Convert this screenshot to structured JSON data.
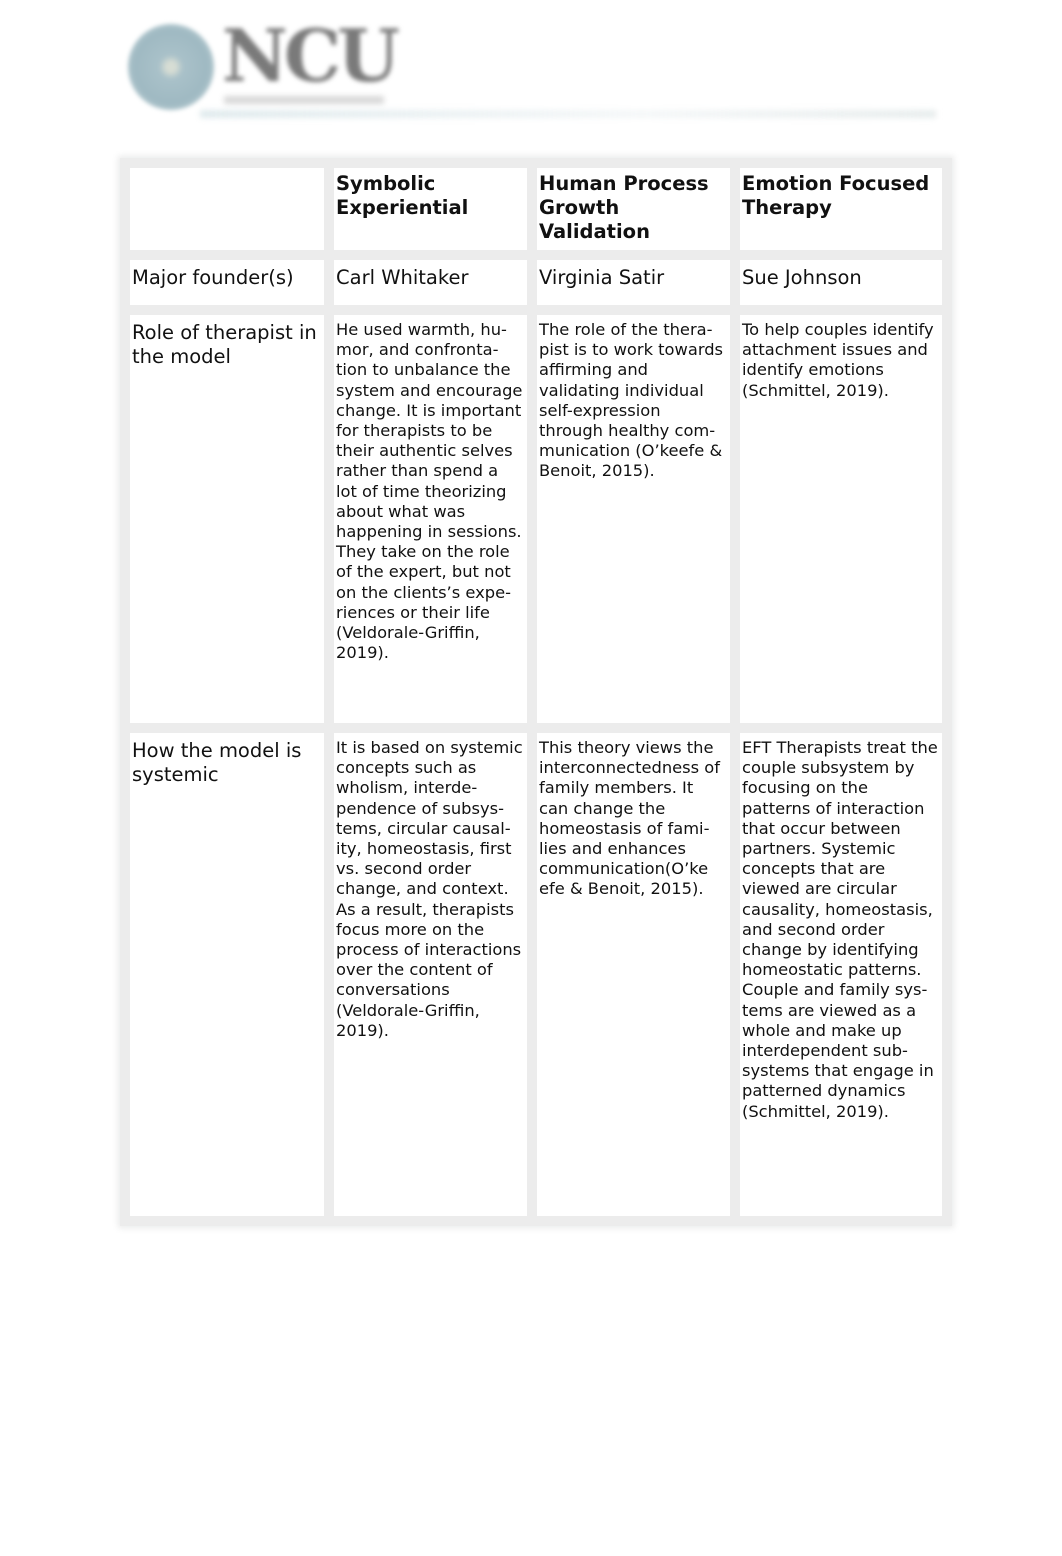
{
  "header": {
    "logo_text": "NCU",
    "logo_icon": "university-seal-icon"
  },
  "table": {
    "columns": [
      "",
      "Symbolic Experiential",
      "Human Process Growth Validation",
      "Emotion Focused Therapy"
    ],
    "rows": [
      {
        "label": "Major founder(s)",
        "cells": [
          "Carl Whitaker",
          "Virginia Satir",
          "Sue Johnson"
        ]
      },
      {
        "label": "Role of therapist in the model",
        "cells": [
          "He used warmth, hu­mor, and confronta­tion to unbalance the system and encour­age change. It is im­portant for therapists to be their authentic selves rather than spend a lot of time theorizing about what was happening in sessions. They take on the role of the expert, but not on the clients’s expe­riences or  their life (Veldorale-Griffin, 2019).",
          "The role of the thera­pist is to work to­wards affirming and validating individual self-expression through healthy com­munication (O’keefe & Benoit, 2015).",
          "To help couples iden­tify attachment is­sues and identify emotions (Schmittel, 2019)."
        ]
      },
      {
        "label": "How the model is systemic",
        "cells": [
          "It is based on sys­temic concepts such as wholism, interde­pendence of subsys­tems, circular causal­ity, homeostasis, first vs. second order change, and context. As a result, thera­pists focus more on the process of inter­actions over the con­tent of conversations (Veldorale-Griffin, 2019).",
          "This theory views the interconnectedness of family members. It can change the homeostasis of fami­lies and enhances communication(O’ke efe & Benoit, 2015).",
          "EFT Therapists treat the couple subsys­tem by focusing on the patterns of inter­action that occur be­tween partners. Sys­temic concepts that are viewed are circu­lar causality, home­ostasis, and second order change by identifying homeo­static patterns. Cou­ple and family sys­tems are viewed as a whole and make up interdependent sub­systems that  engage in patterned dynam­ics (Schmittel, 2019)."
        ]
      }
    ]
  }
}
